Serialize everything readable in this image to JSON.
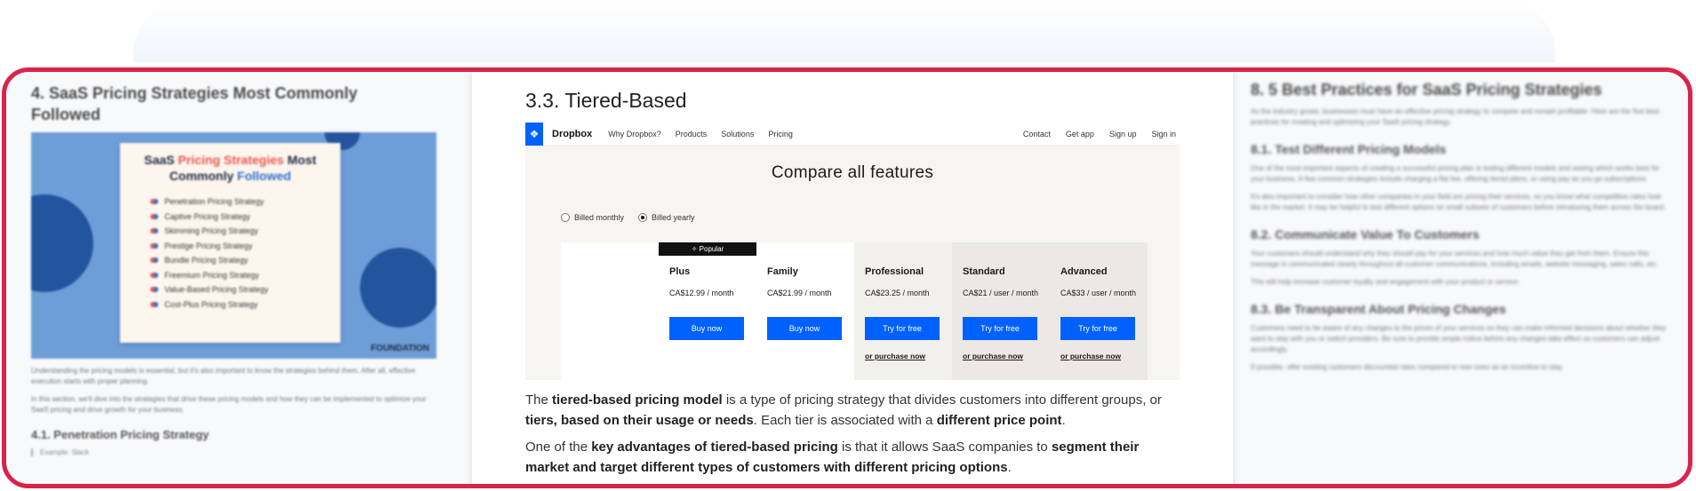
{
  "left": {
    "title": "4. SaaS Pricing Strategies Most Commonly Followed",
    "hero": {
      "title_part1": "SaaS ",
      "title_accent1": "Pricing Strategies",
      "title_part2": " Most Commonly ",
      "title_accent2": "Followed",
      "items": [
        "Penetration Pricing Strategy",
        "Captive Pricing Strategy",
        "Skimming Pricing Strategy",
        "Prestige Pricing Strategy",
        "Bundle Pricing Strategy",
        "Freemium Pricing Strategy",
        "Value-Based Pricing Strategy",
        "Cost-Plus Pricing Strategy"
      ],
      "brand": "FOUNDATION"
    },
    "para1": "Understanding the pricing models is essential, but it's also important to know the strategies behind them. After all, effective execution starts with proper planning.",
    "para2": "In this section, we'll dive into the strategies that drive these pricing models and how they can be implemented to optimize your SaaS pricing and drive growth for your business.",
    "subheading": "4.1. Penetration Pricing Strategy",
    "sub_label": "Example: Slack"
  },
  "center": {
    "title": "3.3. Tiered-Based",
    "dropbox": {
      "brand": "Dropbox",
      "nav_left": [
        "Why Dropbox?",
        "Products",
        "Solutions",
        "Pricing"
      ],
      "nav_right": [
        "Contact",
        "Get app",
        "Sign up",
        "Sign in"
      ],
      "heading": "Compare all features",
      "billing": {
        "monthly": "Billed monthly",
        "yearly": "Billed yearly"
      },
      "popular_label": "✧ Popular",
      "plans": [
        {
          "name": "Plus",
          "price": "CA$12.99 / month",
          "button": "Buy now",
          "alt": ""
        },
        {
          "name": "Family",
          "price": "CA$21.99 / month",
          "button": "Buy now",
          "alt": ""
        },
        {
          "name": "Professional",
          "price": "CA$23.25 / month",
          "button": "Try for free",
          "alt": "or purchase now"
        },
        {
          "name": "Standard",
          "price": "CA$21 / user / month",
          "button": "Try for free",
          "alt": "or purchase now"
        },
        {
          "name": "Advanced",
          "price": "CA$33 / user / month",
          "button": "Try for free",
          "alt": "or purchase now"
        }
      ]
    },
    "para1": {
      "t1": "The ",
      "b1": "tiered-based pricing model",
      "t2": " is a type of pricing strategy that divides customers into different groups, or ",
      "b2": "tiers, based on their usage or needs",
      "t3": ". Each tier is associated with a ",
      "b3": "different price point",
      "t4": "."
    },
    "para2": {
      "t1": "One of the ",
      "b1": "key advantages of tiered-based pricing",
      "t2": " is that it allows SaaS companies to ",
      "b2": "segment their market and target different types of customers with different pricing options",
      "t3": "."
    }
  },
  "right": {
    "title": "8. 5 Best Practices for SaaS Pricing Strategies",
    "intro": "As the industry grows, businesses must have an effective pricing strategy to compete and remain profitable. Here are the five best practices for creating and optimizing your SaaS pricing strategy.",
    "h1": "8.1. Test Different Pricing Models",
    "p1a": "One of the most important aspects of creating a successful pricing plan is testing different models and seeing which works best for your business. A few common strategies include charging a flat fee, offering tiered plans, or using pay as you go subscriptions.",
    "p1b": "It's also important to consider how other companies in your field are pricing their services, so you know what competitive rates look like in the market. It may be helpful to test different options on small subsets of customers before introducing them across the board.",
    "h2": "8.2. Communicate Value To Customers",
    "p2a": "Your customers should understand why they should pay for your services and how much value they get from them. Ensure this message is communicated clearly throughout all customer communications, including emails, website messaging, sales calls, etc.",
    "p2b": "This will help increase customer loyalty and engagement with your product or service.",
    "h3": "8.3. Be Transparent About Pricing Changes",
    "p3a": "Customers need to be aware of any changes to the prices of your services so they can make informed decisions about whether they want to stay with you or switch providers. Be sure to provide ample notice before any changes take effect so customers can adjust accordingly.",
    "p3b": "If possible, offer existing customers discounted rates compared to new ones as an incentive to stay."
  },
  "colors": {
    "frame": "#d8244a",
    "dropbox_blue": "#0061fe"
  }
}
